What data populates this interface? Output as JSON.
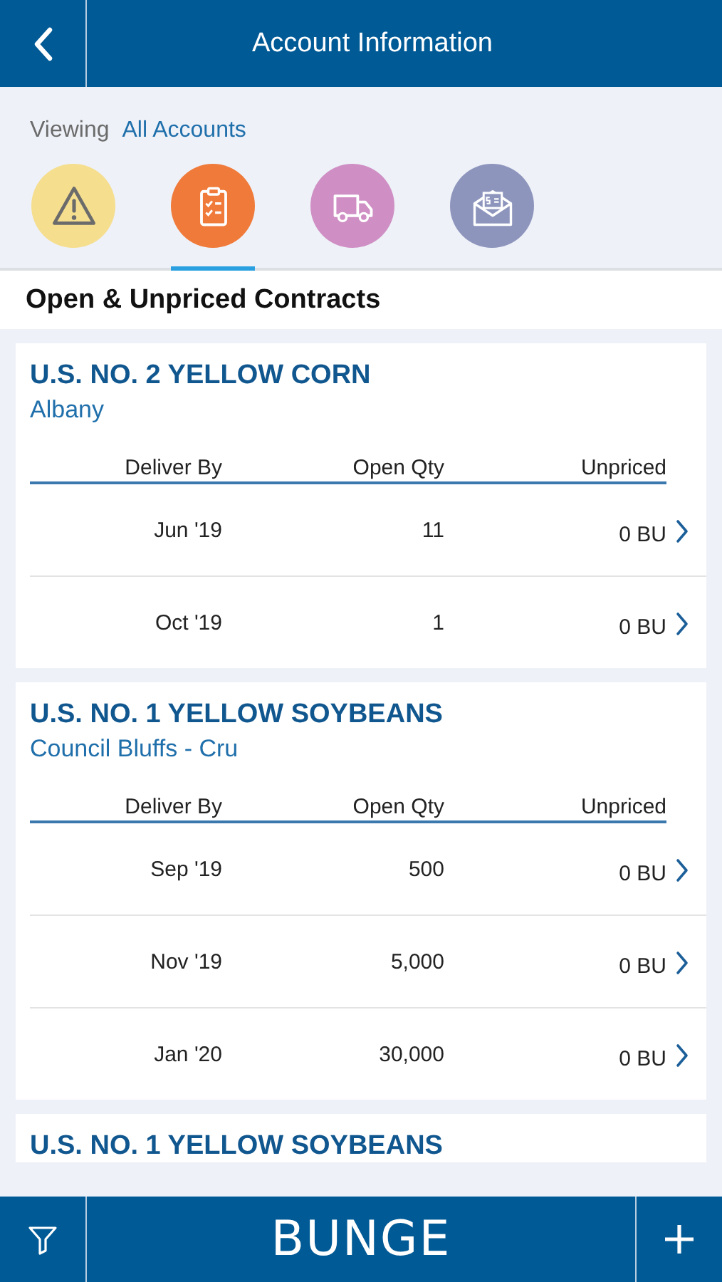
{
  "header": {
    "title": "Account Information"
  },
  "viewing": {
    "label": "Viewing",
    "value": "All Accounts"
  },
  "categories": [
    {
      "kind": "alert",
      "selected": false
    },
    {
      "kind": "contracts",
      "selected": true
    },
    {
      "kind": "delivery",
      "selected": false
    },
    {
      "kind": "payments",
      "selected": false
    }
  ],
  "section_title": "Open & Unpriced Contracts",
  "contracts": [
    {
      "commodity": "U.S. NO. 2 YELLOW CORN",
      "location": "Albany",
      "columns": [
        "Deliver By",
        "Open Qty",
        "Unpriced"
      ],
      "rows": [
        {
          "deliver_by": "Jun '19",
          "open_qty": "11",
          "unpriced": "0 BU"
        },
        {
          "deliver_by": "Oct '19",
          "open_qty": "1",
          "unpriced": "0 BU"
        }
      ]
    },
    {
      "commodity": "U.S. NO. 1 YELLOW SOYBEANS",
      "location": "Council Bluffs - Cru",
      "columns": [
        "Deliver By",
        "Open Qty",
        "Unpriced"
      ],
      "rows": [
        {
          "deliver_by": "Sep '19",
          "open_qty": "500",
          "unpriced": "0 BU"
        },
        {
          "deliver_by": "Nov '19",
          "open_qty": "5,000",
          "unpriced": "0 BU"
        },
        {
          "deliver_by": "Jan '20",
          "open_qty": "30,000",
          "unpriced": "0 BU"
        }
      ]
    },
    {
      "commodity": "U.S. NO. 1 YELLOW SOYBEANS"
    }
  ],
  "footer": {
    "brand": "BUNGE"
  }
}
